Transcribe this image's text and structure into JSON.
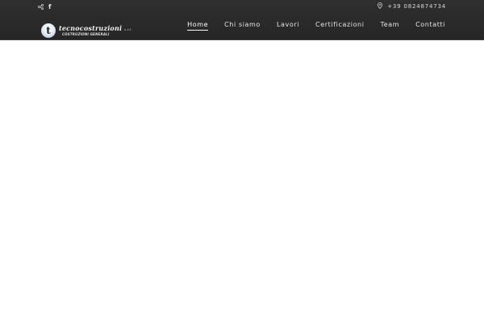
{
  "topbar": {
    "social": {
      "share_icon": "share-icon",
      "facebook_icon": "facebook-icon",
      "facebook_label": "f"
    },
    "phone": {
      "icon": "location-pin-icon",
      "number": "+39 0824874734"
    }
  },
  "logo": {
    "mark": "t",
    "name": "tecnocostruzioni",
    "suffix": "s.r.l.",
    "tagline": "COSTRUZIONI GENERALI"
  },
  "nav": {
    "items": [
      {
        "label": "Home",
        "active": true
      },
      {
        "label": "Chi siamo",
        "active": false
      },
      {
        "label": "Lavori",
        "active": false
      },
      {
        "label": "Certificazioni",
        "active": false
      },
      {
        "label": "Team",
        "active": false
      },
      {
        "label": "Contatti",
        "active": false
      }
    ]
  },
  "colors": {
    "header_bg": "#2b2b2b",
    "nav_text": "#e6e6e6",
    "page_bg": "#ffffff"
  }
}
